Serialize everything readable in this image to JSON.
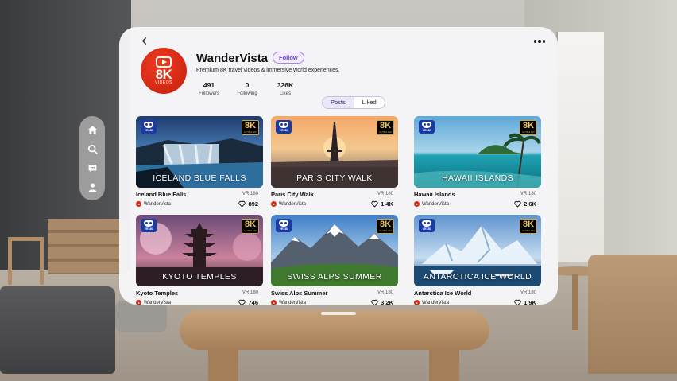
{
  "channel": {
    "name": "WanderVista",
    "follow_label": "Follow",
    "description": "Premium 8K travel videos & immersive world experiences.",
    "avatar": {
      "big": "8K",
      "small": "VIDEOS",
      "icon": "play-icon"
    },
    "stats": [
      {
        "value": "491",
        "label": "Followers"
      },
      {
        "value": "0",
        "label": "Following"
      },
      {
        "value": "326K",
        "label": "Likes"
      }
    ]
  },
  "tabs": [
    {
      "label": "Posts",
      "active": true
    },
    {
      "label": "Liked",
      "active": false
    }
  ],
  "sidebar": {
    "items": [
      {
        "icon": "home-icon"
      },
      {
        "icon": "search-icon"
      },
      {
        "icon": "messages-icon"
      },
      {
        "icon": "profile-icon"
      }
    ]
  },
  "badges": {
    "vr": "VR180",
    "k_main": "8K",
    "k_sub": "ULTRA HD"
  },
  "videos": [
    {
      "overlay": "ICELAND BLUE FALLS",
      "title": "Iceland Blue Falls",
      "tag": "VR 180",
      "author": "WanderVista",
      "likes": "892",
      "scene": "falls"
    },
    {
      "overlay": "PARIS CITY WALK",
      "title": "Paris City Walk",
      "tag": "VR 180",
      "author": "WanderVista",
      "likes": "1.4K",
      "scene": "paris"
    },
    {
      "overlay": "HAWAII ISLANDS",
      "title": "Hawaii Islands",
      "tag": "VR 180",
      "author": "WanderVista",
      "likes": "2.6K",
      "scene": "hawaii"
    },
    {
      "overlay": "KYOTO TEMPLES",
      "title": "Kyoto Temples",
      "tag": "VR 180",
      "author": "WanderVista",
      "likes": "746",
      "scene": "kyoto"
    },
    {
      "overlay": "SWISS ALPS SUMMER",
      "title": "Swiss Alps Summer",
      "tag": "VR 180",
      "author": "WanderVista",
      "likes": "3.2K",
      "scene": "alps"
    },
    {
      "overlay": "ANTARCTICA ICE WORLD",
      "title": "Antarctica Ice World",
      "tag": "VR 180",
      "author": "WanderVista",
      "likes": "1.9K",
      "scene": "antarctica"
    }
  ],
  "colors": {
    "accent": "#6b3fd3",
    "brand": "#d62b14",
    "badge_blue": "#1b3aa6",
    "badge_gold": "#e9c45a"
  }
}
